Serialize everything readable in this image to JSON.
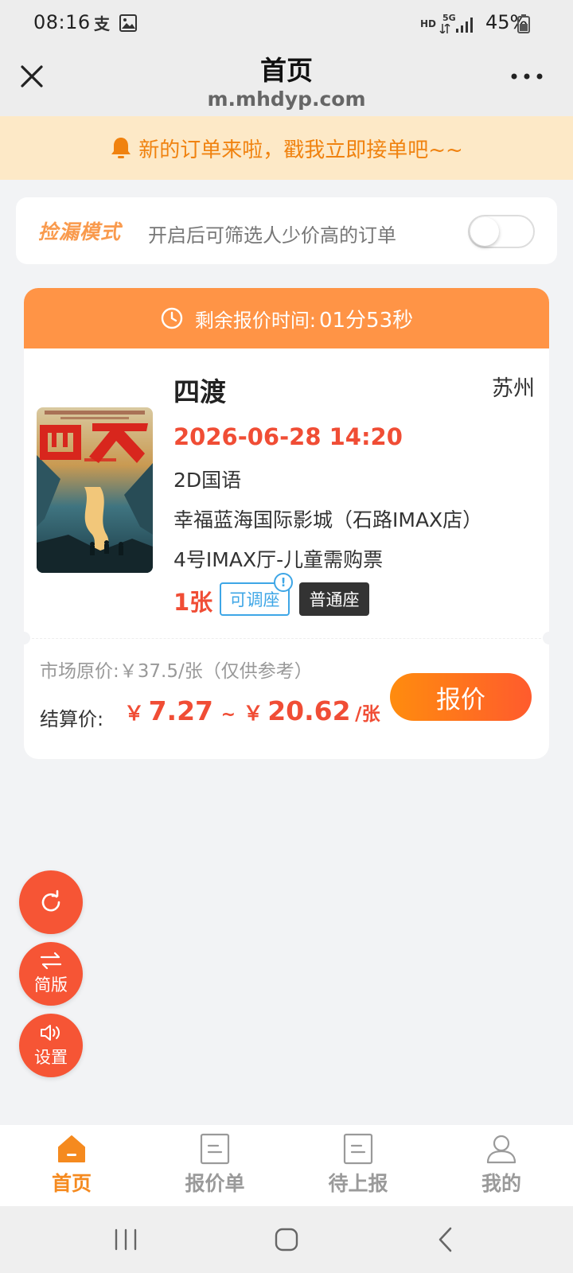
{
  "status_bar": {
    "time": "08:16",
    "network_hd": "HD",
    "network_5g": "5G",
    "battery": "45%"
  },
  "header": {
    "title": "首页",
    "subtitle": "m.mhdyp.com"
  },
  "notice": {
    "text": "新的订单来啦，戳我立即接单吧~~"
  },
  "mode": {
    "badge": "捡漏模式",
    "description": "开启后可筛选人少价高的订单",
    "enabled": false
  },
  "order": {
    "timer_label": "剩余报价时间:",
    "timer_value": "01分53秒",
    "movie_title": "四渡",
    "city": "苏州",
    "showtime": "2026-06-28 14:20",
    "format": "2D国语",
    "cinema": "幸福蓝海国际影城（石路IMAX店）",
    "hall": "4号IMAX厅-儿童需购票",
    "ticket_count": "1张",
    "tag_adjustable": "可调座",
    "tag_info": "!",
    "tag_seat": "普通座",
    "market_price": "市场原价:￥37.5/张（仅供参考）",
    "settle_label": "结算价:",
    "currency": "￥",
    "settle_min": "7.27",
    "range_sep": "~",
    "settle_max": "20.62",
    "unit": "/张",
    "quote_button": "报价"
  },
  "fabs": {
    "refresh_icon": "refresh-icon",
    "simple_label": "简版",
    "settings_label": "设置"
  },
  "tabbar": {
    "items": [
      {
        "label": "首页",
        "icon": "home-icon",
        "active": true
      },
      {
        "label": "报价单",
        "icon": "document-icon",
        "active": false
      },
      {
        "label": "待上报",
        "icon": "document-icon",
        "active": false
      },
      {
        "label": "我的",
        "icon": "user-icon",
        "active": false
      }
    ]
  },
  "colors": {
    "accent": "#f58a1f",
    "price_red": "#f04d35",
    "timer_orange": "#ff9446",
    "notice_bg": "#fde9c7"
  }
}
